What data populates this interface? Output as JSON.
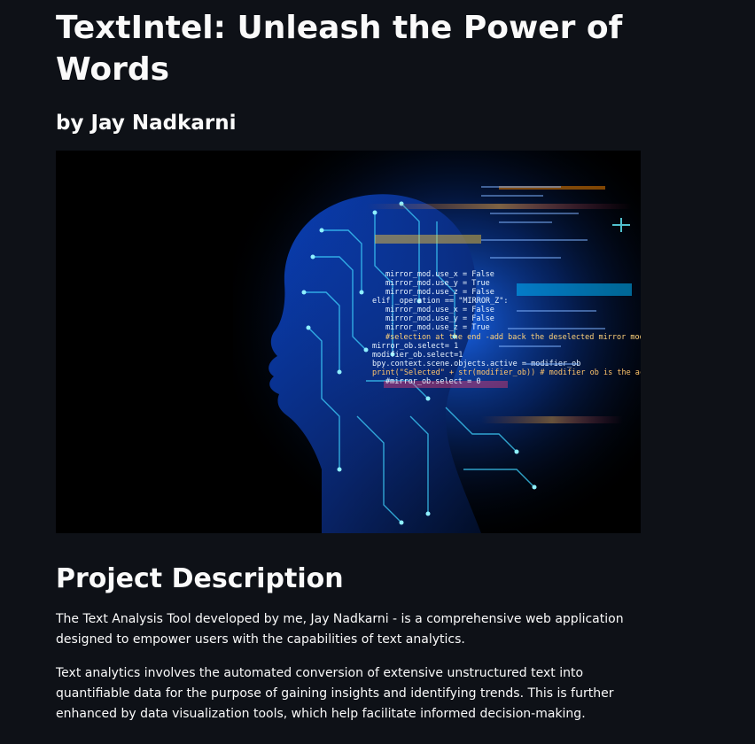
{
  "header": {
    "title": "TextIntel: Unleash the Power of Words",
    "byline": "by Jay Nadkarni"
  },
  "hero_image": {
    "alt": "AI head silhouette with circuitry and code",
    "code_lines": [
      "mirror_mod.use_x = False",
      "mirror_mod.use_y = True",
      "mirror_mod.use_z = False",
      "elif _operation == \"MIRROR_Z\":",
      "mirror_mod.use_x = False",
      "mirror_mod.use_y = False",
      "mirror_mod.use_z = True",
      "#selection at the end -add back the deselected mirror modifier object",
      "mirror_ob.select= 1",
      "modifier_ob.select=1",
      "bpy.context.scene.objects.active = modifier_ob",
      "print(\"Selected\" + str(modifier_ob)) # modifier ob is the active ob",
      "#mirror_ob.select = 0"
    ]
  },
  "section": {
    "heading": "Project Description",
    "paragraphs": [
      "The Text Analysis Tool developed by me, Jay Nadkarni - is a comprehensive web application designed to empower users with the capabilities of text analytics.",
      "Text analytics involves the automated conversion of extensive unstructured text into quantifiable data for the purpose of gaining insights and identifying trends. This is further enhanced by data visualization tools, which help facilitate informed decision-making."
    ]
  },
  "colors": {
    "background": "#0e1117",
    "text": "#fafafa",
    "accent_blue": "#1e90ff",
    "accent_cyan": "#00e5ff"
  }
}
